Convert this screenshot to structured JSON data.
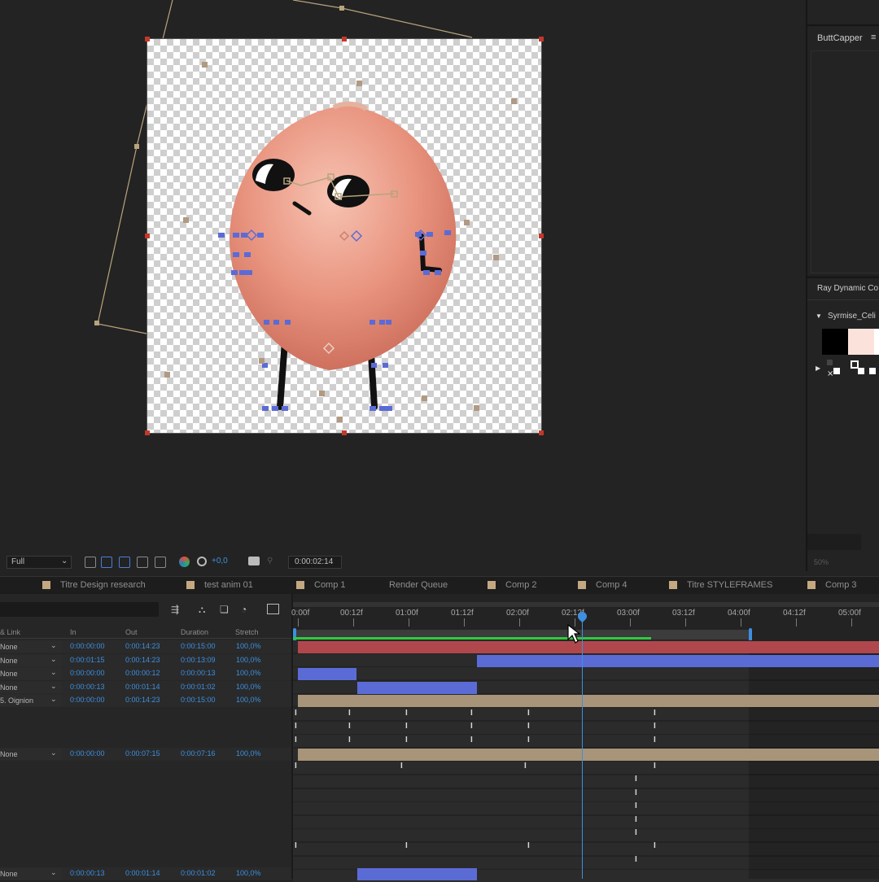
{
  "viewer": {
    "resolution": "Full",
    "exposure": "+0,0",
    "timecode": "0:00:02:14",
    "zoom_hint": "50%"
  },
  "right_panels": {
    "panel1_title": "ButtCapper",
    "panel2_title": "Ray Dynamic Co",
    "palette_name": "Syrmise_Celi"
  },
  "tabs": [
    {
      "label": "Titre Design research",
      "swatch": true
    },
    {
      "label": "test anim 01",
      "swatch": true
    },
    {
      "label": "Comp 1",
      "swatch": true
    },
    {
      "label": "Render Queue",
      "swatch": false
    },
    {
      "label": "Comp 2",
      "swatch": true
    },
    {
      "label": "Comp 4",
      "swatch": true
    },
    {
      "label": "Titre STYLEFRAMES",
      "swatch": true
    },
    {
      "label": "Comp 3",
      "swatch": true
    }
  ],
  "timeline": {
    "columns": {
      "parent": "& Link",
      "in": "In",
      "out": "Out",
      "duration": "Duration",
      "stretch": "Stretch"
    },
    "ruler_labels": [
      "0:00f",
      "00:12f",
      "01:00f",
      "01:12f",
      "02:00f",
      "02:12f",
      "03:00f",
      "03:12f",
      "04:00f",
      "04:12f",
      "05:00f"
    ],
    "layers": [
      {
        "parent": "None",
        "in": "0:00:00:00",
        "out": "0:00:14:23",
        "duration": "0:00:15:00",
        "stretch": "100,0%"
      },
      {
        "parent": "None",
        "in": "0:00:01:15",
        "out": "0:00:14:23",
        "duration": "0:00:13:09",
        "stretch": "100,0%"
      },
      {
        "parent": "None",
        "in": "0:00:00:00",
        "out": "0:00:00:12",
        "duration": "0:00:00:13",
        "stretch": "100,0%"
      },
      {
        "parent": "None",
        "in": "0:00:00:13",
        "out": "0:00:01:14",
        "duration": "0:00:01:02",
        "stretch": "100,0%"
      },
      {
        "parent": "5. Oignion",
        "in": "0:00:00:00",
        "out": "0:00:14:23",
        "duration": "0:00:15:00",
        "stretch": "100,0%"
      },
      {
        "parent": "None",
        "in": "0:00:00:00",
        "out": "0:00:07:15",
        "duration": "0:00:07:16",
        "stretch": "100,0%"
      },
      {
        "parent": "None",
        "in": "0:00:00:13",
        "out": "0:00:01:14",
        "duration": "0:00:01:02",
        "stretch": "100,0%"
      }
    ]
  }
}
